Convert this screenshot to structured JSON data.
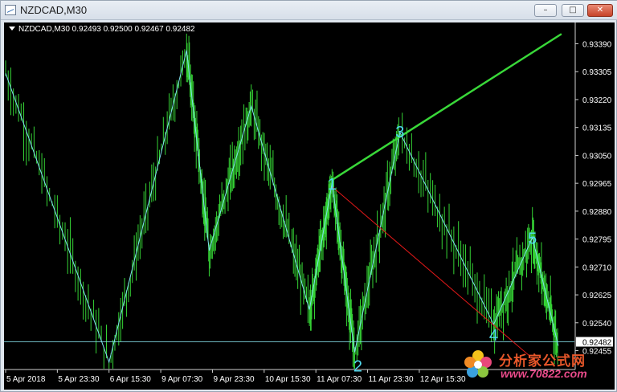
{
  "window": {
    "title": "NZDCAD,M30",
    "controls": {
      "minimize": "–",
      "maximize": "□",
      "close": "✕"
    },
    "icons": [
      "chart-window-icon"
    ]
  },
  "symbol_bar": {
    "text": "NZDCAD,M30  0.92493 0.92500 0.92467 0.92482"
  },
  "colors": {
    "background": "#000000",
    "candles": "#35d335",
    "zigzag": "#7fe0ee",
    "trendline": "#39d839",
    "channel": "#e01818",
    "hline": "#7fd6e0",
    "labels": "#4fd9ee",
    "axis_text": "#ffffff",
    "current_price_bg": "#ffffff"
  },
  "chart_data": {
    "type": "ohlc",
    "symbol": "NZDCAD",
    "timeframe": "M30",
    "last_quote": {
      "open": 0.92493,
      "high": 0.925,
      "low": 0.92467,
      "close": 0.92482
    },
    "current_price": 0.92482,
    "ylim": [
      0.924,
      0.9345
    ],
    "y_ticks": [
      "0.93390",
      "0.93305",
      "0.93220",
      "0.93135",
      "0.93050",
      "0.92965",
      "0.92880",
      "0.92795",
      "0.92710",
      "0.92625",
      "0.92540",
      "0.92455"
    ],
    "y_tick_values": [
      0.9339,
      0.93305,
      0.9322,
      0.93135,
      0.9305,
      0.92965,
      0.9288,
      0.92795,
      0.9271,
      0.92625,
      0.9254,
      0.92455
    ],
    "x_ticks": [
      "5 Apr 2018",
      "5 Apr 23:30",
      "6 Apr 15:30",
      "9 Apr 07:30",
      "9 Apr 23:30",
      "10 Apr 15:30",
      "11 Apr 07:30",
      "11 Apr 23:30",
      "12 Apr 15:30"
    ],
    "x_range_bars": [
      0,
      176
    ],
    "x_tick_bars": [
      0,
      16,
      32,
      48,
      64,
      80,
      96,
      112,
      128
    ],
    "zigzag_points": [
      {
        "bar": 0,
        "price": 0.933
      },
      {
        "bar": 32,
        "price": 0.9242
      },
      {
        "bar": 56,
        "price": 0.9337
      },
      {
        "bar": 63,
        "price": 0.9276
      },
      {
        "bar": 76,
        "price": 0.932
      },
      {
        "bar": 94,
        "price": 0.9258
      },
      {
        "bar": 101,
        "price": 0.92965
      },
      {
        "bar": 108,
        "price": 0.9245
      },
      {
        "bar": 122,
        "price": 0.9312
      },
      {
        "bar": 151,
        "price": 0.92535
      },
      {
        "bar": 163,
        "price": 0.928
      },
      {
        "bar": 171,
        "price": 0.9247
      }
    ],
    "wave_labels": [
      {
        "text": "1",
        "bar": 101,
        "price": 0.92965
      },
      {
        "text": "2",
        "bar": 109,
        "price": 0.9245
      },
      {
        "text": "3",
        "bar": 122,
        "price": 0.9312
      },
      {
        "text": "4",
        "bar": 151,
        "price": 0.92535
      },
      {
        "text": "5",
        "bar": 163,
        "price": 0.928
      }
    ],
    "trendline": {
      "from": {
        "bar": 101,
        "price": 0.92975
      },
      "to": {
        "bar": 172,
        "price": 0.9342
      }
    },
    "channel_line": {
      "from": {
        "bar": 101,
        "price": 0.92955
      },
      "to": {
        "bar": 162,
        "price": 0.9244
      }
    }
  },
  "watermark": {
    "title": "分析家公式网",
    "url": "www.70822.com"
  }
}
